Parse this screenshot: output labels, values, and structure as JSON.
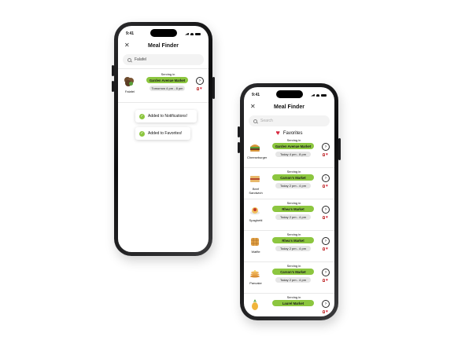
{
  "phone_left": {
    "status_time": "9:41",
    "title": "Meal Finder",
    "close_glyph": "✕",
    "search_value": "Falafel",
    "result": {
      "food_name": "Falafel",
      "serving_label": "Serving in",
      "market": "Garden Avenue Market",
      "time": "Tomorrow 4 pm - 8 pm",
      "icon": "falafel-icon"
    },
    "toasts": [
      "Added to Notifications!",
      "Added to Favorites!"
    ]
  },
  "phone_right": {
    "status_time": "9:41",
    "title": "Meal Finder",
    "close_glyph": "✕",
    "search_placeholder": "Search",
    "favorites_title": "Favorites",
    "rows": [
      {
        "food_name": "Cheeseburger",
        "serving_label": "Serving in",
        "market": "Garden Avenue Market",
        "time": "Today 4 pm - 8 pm",
        "icon": "burger-icon"
      },
      {
        "food_name": "Beef Sandwich",
        "serving_label": "Serving in",
        "market": "Carson's Market",
        "time": "Today 2 pm - 4 pm",
        "icon": "sandwich-icon"
      },
      {
        "food_name": "Spaghetti",
        "serving_label": "Serving in",
        "market": "Rhea's Market",
        "time": "Today 2 pm - 4 pm",
        "icon": "spaghetti-icon"
      },
      {
        "food_name": "Waffle",
        "serving_label": "Serving in",
        "market": "Rhea's Market",
        "time": "Today 2 pm - 4 pm",
        "icon": "waffle-icon"
      },
      {
        "food_name": "Pancake",
        "serving_label": "Serving in",
        "market": "Carson's Market",
        "time": "Today 2 pm - 4 pm",
        "icon": "pancake-icon"
      },
      {
        "food_name": "",
        "serving_label": "Serving in",
        "market": "Laurel Market",
        "time": "",
        "icon": "pineapple-icon"
      }
    ]
  },
  "colors": {
    "accent_green": "#8cc63f",
    "heart_red": "#d7263d",
    "pill_grey": "#e6e6e6"
  }
}
